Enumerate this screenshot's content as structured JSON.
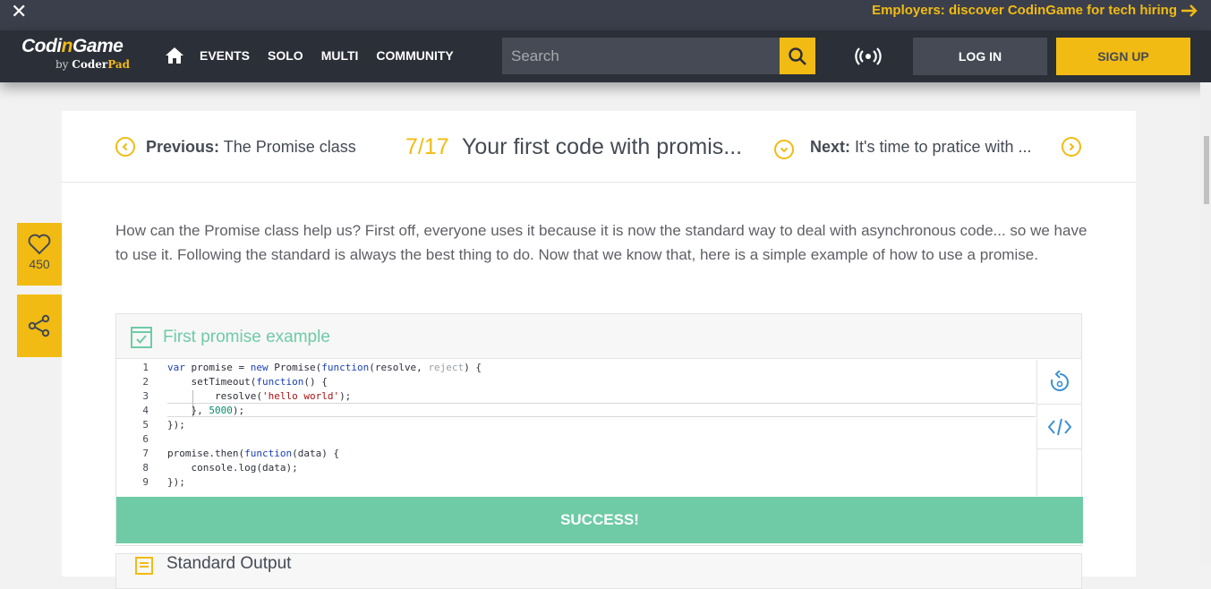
{
  "banner": {
    "close_glyph": "✕",
    "promo": "Employers: discover CodinGame for tech hiring"
  },
  "logo": {
    "prefix": "Codi",
    "accent": "n",
    "suffix": "Game",
    "by": "by ",
    "coder": "Coder",
    "pad": "Pad"
  },
  "nav": {
    "items": [
      {
        "label": "EVENTS"
      },
      {
        "label": "SOLO"
      },
      {
        "label": "MULTI"
      },
      {
        "label": "COMMUNITY"
      }
    ],
    "search_placeholder": "Search",
    "login": "LOG IN",
    "signup": "SIGN UP"
  },
  "sidebar": {
    "likes": "450"
  },
  "lesson": {
    "prev_label": "Previous:",
    "prev_title": "The Promise class",
    "counter": "7/17",
    "title": "Your first code with promis...",
    "next_label": "Next:",
    "next_title": "It's time to pratice with ..."
  },
  "paragraph": "How can the Promise class help us? First off, everyone uses it because it is now the standard way to deal with asynchronous code... so we have to use it. Following the standard is always the best thing to do. Now that we know that, here is a simple example of how to use a promise.",
  "example": {
    "title": "First promise example",
    "line_numbers": [
      "1",
      "2",
      "3",
      "4",
      "5",
      "6",
      "7",
      "8",
      "9"
    ],
    "success": "SUCCESS!"
  },
  "stdout": {
    "title": "Standard Output"
  },
  "colors": {
    "accent": "#f2bb13",
    "success": "#6ecba6",
    "dark": "#2b2f38"
  },
  "icons": [
    "close-icon",
    "arrow-right-icon",
    "home-icon",
    "search-icon",
    "live-icon",
    "heart-icon",
    "share-icon",
    "chevron-left-icon",
    "chevron-down-icon",
    "chevron-right-icon",
    "checkbox-icon",
    "reset-icon",
    "code-icon",
    "output-icon"
  ]
}
